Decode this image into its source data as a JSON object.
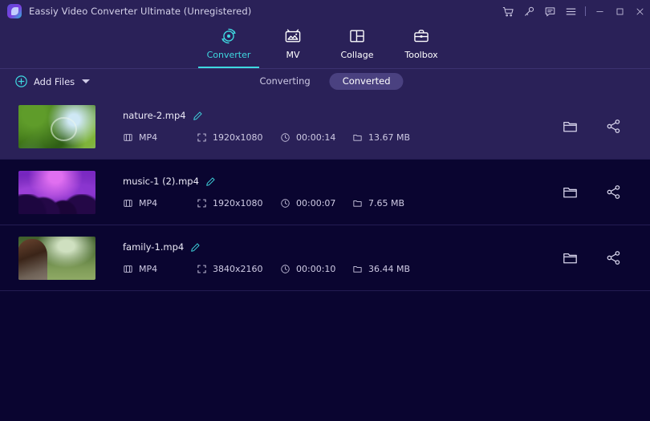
{
  "window": {
    "title": "Eassiy Video Converter Ultimate (Unregistered)",
    "logo_icon": "app-logo-icon",
    "controls": [
      {
        "name": "cart-icon",
        "label": "Buy"
      },
      {
        "name": "key-icon",
        "label": "Register"
      },
      {
        "name": "feedback-icon",
        "label": "Feedback"
      },
      {
        "name": "hamburger-icon",
        "label": "Menu"
      },
      {
        "name": "minimize-icon",
        "label": "Minimize"
      },
      {
        "name": "maximize-icon",
        "label": "Maximize"
      },
      {
        "name": "close-icon",
        "label": "Close"
      }
    ]
  },
  "nav": {
    "active": "Converter",
    "tabs": [
      {
        "label": "Converter",
        "icon": "converter-icon"
      },
      {
        "label": "MV",
        "icon": "mv-icon"
      },
      {
        "label": "Collage",
        "icon": "collage-icon"
      },
      {
        "label": "Toolbox",
        "icon": "toolbox-icon"
      }
    ]
  },
  "toolbar": {
    "add_files_label": "Add Files",
    "add_files_icon": "plus-circle-icon",
    "dropdown_icon": "caret-down-icon",
    "segments": [
      {
        "label": "Converting",
        "active": false
      },
      {
        "label": "Converted",
        "active": true
      }
    ]
  },
  "file_list": {
    "rows": [
      {
        "filename": "nature-2.mp4",
        "format": "MP4",
        "resolution": "1920x1080",
        "duration": "00:00:14",
        "size": "13.67 MB",
        "selected": true,
        "thumb_class": "art-forest"
      },
      {
        "filename": "music-1 (2).mp4",
        "format": "MP4",
        "resolution": "1920x1080",
        "duration": "00:00:07",
        "size": "7.65 MB",
        "selected": false,
        "thumb_class": "art-concert"
      },
      {
        "filename": "family-1.mp4",
        "format": "MP4",
        "resolution": "3840x2160",
        "duration": "00:00:10",
        "size": "36.44 MB",
        "selected": false,
        "thumb_class": "art-park"
      }
    ],
    "row_actions": [
      {
        "name": "open-folder-icon",
        "label": "Open folder"
      },
      {
        "name": "share-icon",
        "label": "Share"
      }
    ]
  },
  "colors": {
    "titlebar_bg": "#2a2158",
    "content_bg": "#0a0530",
    "accent": "#3fd8e0",
    "selected_row_bg": "#2a2158",
    "pill_active_bg": "#4a4180"
  }
}
